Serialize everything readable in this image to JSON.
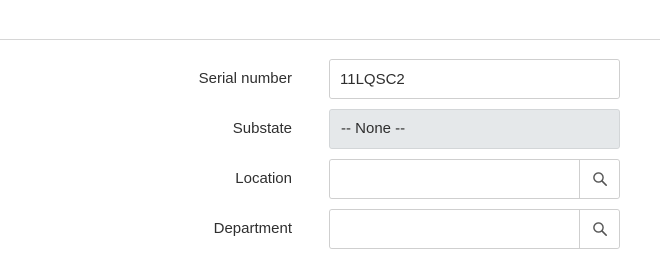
{
  "form": {
    "fields": [
      {
        "label": "Serial number",
        "value": "11LQSC2"
      },
      {
        "label": "Substate",
        "value": "-- None --"
      },
      {
        "label": "Location",
        "value": ""
      },
      {
        "label": "Department",
        "value": ""
      }
    ]
  },
  "icons": {
    "lookup": "search-icon"
  },
  "colors": {
    "readonly_background": "#e5e8ea",
    "field_border": "#cfcfcf",
    "label_text": "#2f2f2f"
  }
}
